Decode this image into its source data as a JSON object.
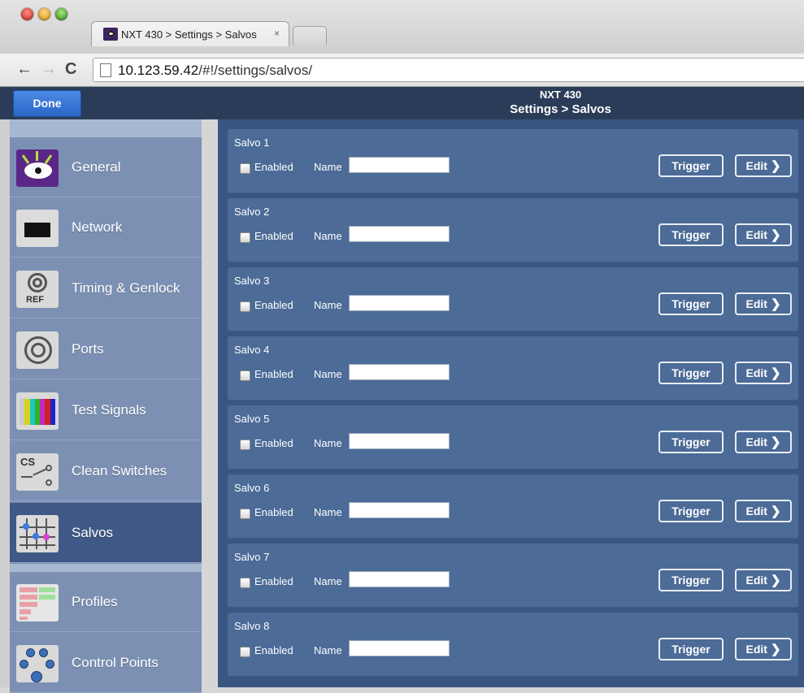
{
  "browser": {
    "tab_title": "NXT 430 > Settings > Salvos",
    "tab_close": "×",
    "url_host": "10.123.59.42",
    "url_path": "/#!/settings/salvos/",
    "back_glyph": "←",
    "forward_glyph": "→",
    "reload_glyph": "C"
  },
  "header": {
    "done_label": "Done",
    "device": "NXT 430",
    "title": "Settings > Salvos",
    "bg_color": "#2a3c58"
  },
  "sidebar": {
    "items": [
      {
        "label": "General",
        "icon": "eye-icon"
      },
      {
        "label": "Network",
        "icon": "ethernet-port-icon"
      },
      {
        "label": "Timing & Genlock",
        "icon": "ref-connector-icon",
        "icon_text": "REF"
      },
      {
        "label": "Ports",
        "icon": "bnc-connector-icon"
      },
      {
        "label": "Test Signals",
        "icon": "color-bars-icon"
      },
      {
        "label": "Clean Switches",
        "icon": "switch-icon",
        "icon_text": "CS"
      },
      {
        "label": "Salvos",
        "icon": "salvo-grid-icon",
        "active": true
      },
      {
        "label": "Profiles",
        "icon": "profiles-icon"
      },
      {
        "label": "Control Points",
        "icon": "control-points-icon"
      }
    ]
  },
  "salvo_labels": {
    "enabled": "Enabled",
    "name": "Name",
    "trigger": "Trigger",
    "edit": "Edit",
    "edit_chevron": "❯"
  },
  "salvos": [
    {
      "title": "Salvo 1",
      "enabled": false,
      "name": ""
    },
    {
      "title": "Salvo 2",
      "enabled": false,
      "name": ""
    },
    {
      "title": "Salvo 3",
      "enabled": false,
      "name": ""
    },
    {
      "title": "Salvo 4",
      "enabled": false,
      "name": ""
    },
    {
      "title": "Salvo 5",
      "enabled": false,
      "name": ""
    },
    {
      "title": "Salvo 6",
      "enabled": false,
      "name": ""
    },
    {
      "title": "Salvo 7",
      "enabled": false,
      "name": ""
    },
    {
      "title": "Salvo 8",
      "enabled": false,
      "name": ""
    }
  ],
  "colors": {
    "content_bg": "#3b5583",
    "card_bg": "#4c6b97",
    "sidebar_bg": "#7b90b3",
    "sidebar_active": "#3f5886",
    "done_button": "#2c66c8"
  }
}
